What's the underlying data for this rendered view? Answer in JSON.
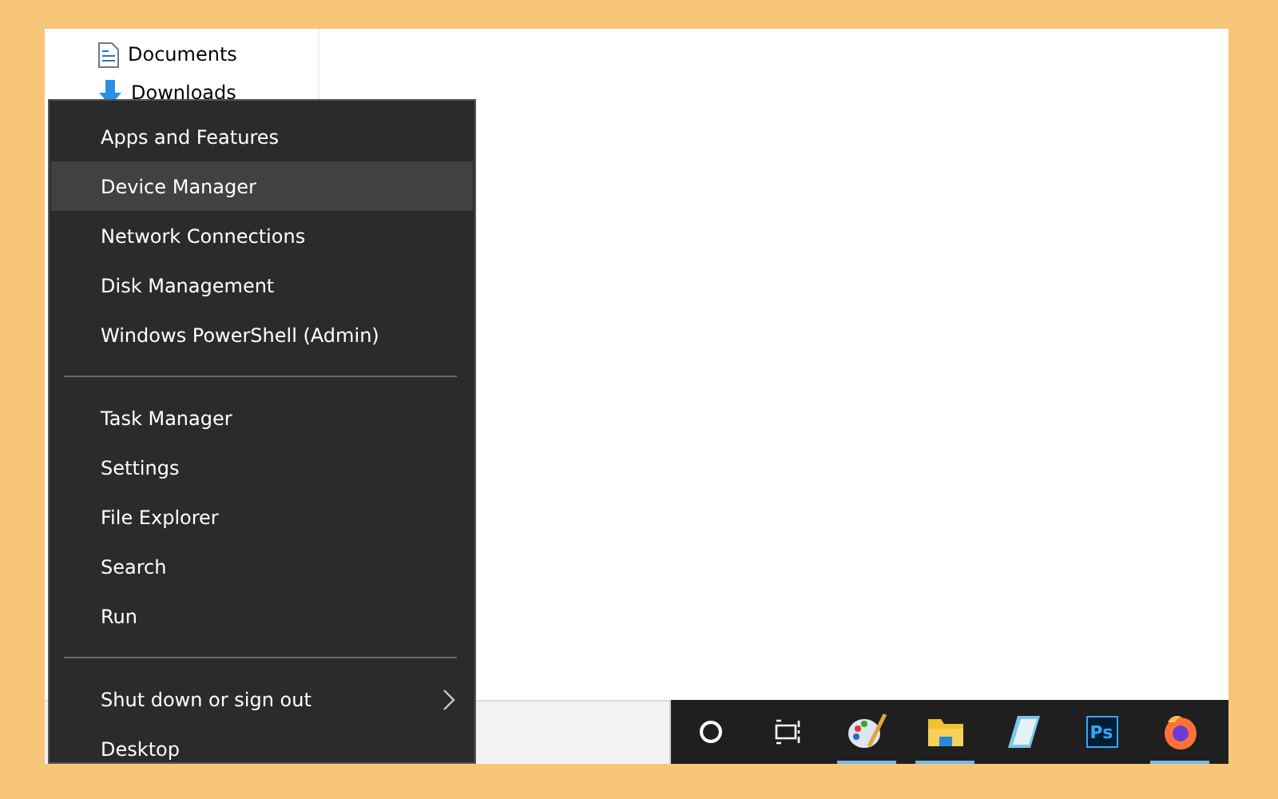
{
  "explorer": {
    "sidebar": {
      "items": [
        {
          "kind": "documents",
          "label": "Documents"
        },
        {
          "kind": "downloads",
          "label": "Downloads"
        }
      ]
    }
  },
  "menu": {
    "groups": [
      [
        {
          "label": "Apps and Features",
          "selected": false,
          "has_submenu": false
        },
        {
          "label": "Device Manager",
          "selected": true,
          "has_submenu": false
        },
        {
          "label": "Network Connections",
          "selected": false,
          "has_submenu": false
        },
        {
          "label": "Disk Management",
          "selected": false,
          "has_submenu": false
        },
        {
          "label": "Windows PowerShell (Admin)",
          "selected": false,
          "has_submenu": false
        }
      ],
      [
        {
          "label": "Task Manager",
          "selected": false,
          "has_submenu": false
        },
        {
          "label": "Settings",
          "selected": false,
          "has_submenu": false
        },
        {
          "label": "File Explorer",
          "selected": false,
          "has_submenu": false
        },
        {
          "label": "Search",
          "selected": false,
          "has_submenu": false
        },
        {
          "label": "Run",
          "selected": false,
          "has_submenu": false
        }
      ],
      [
        {
          "label": "Shut down or sign out",
          "selected": false,
          "has_submenu": true
        },
        {
          "label": "Desktop",
          "selected": false,
          "has_submenu": false
        }
      ]
    ]
  },
  "taskbar": {
    "icons": [
      {
        "kind": "cortana",
        "running": false
      },
      {
        "kind": "task-view",
        "running": false
      },
      {
        "kind": "paint",
        "running": true
      },
      {
        "kind": "explorer",
        "running": true
      },
      {
        "kind": "notepad",
        "running": false
      },
      {
        "kind": "photoshop",
        "label": "Ps",
        "running": false
      },
      {
        "kind": "firefox",
        "running": true
      }
    ]
  }
}
